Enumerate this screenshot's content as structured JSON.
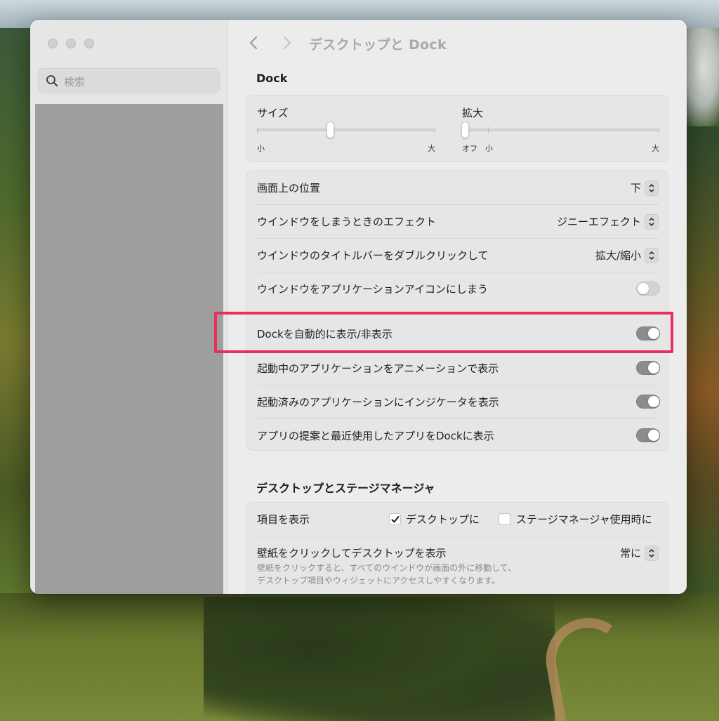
{
  "window": {
    "title": "デスクトップと Dock"
  },
  "sidebar": {
    "search_placeholder": "検索"
  },
  "dock": {
    "section_title": "Dock",
    "size": {
      "label": "サイズ",
      "min_label": "小",
      "max_label": "大",
      "value_fraction": 0.4
    },
    "magnification": {
      "label": "拡大",
      "off_label": "オフ",
      "min_label": "小",
      "max_label": "大",
      "value_fraction": 0.0
    },
    "position_label": "画面上の位置",
    "position_value": "下",
    "minimize_effect_label": "ウインドウをしまうときのエフェクト",
    "minimize_effect_value": "ジニーエフェクト",
    "titlebar_doubleclick_label": "ウインドウのタイトルバーをダブルクリックして",
    "titlebar_doubleclick_value": "拡大/縮小",
    "minimize_to_icon_label": "ウインドウをアプリケーションアイコンにしまう",
    "minimize_to_icon_on": false,
    "autohide_label": "Dockを自動的に表示/非表示",
    "autohide_on": true,
    "animate_label": "起動中のアプリケーションをアニメーションで表示",
    "animate_on": true,
    "indicators_label": "起動済みのアプリケーションにインジケータを表示",
    "indicators_on": true,
    "suggested_label": "アプリの提案と最近使用したアプリをDockに表示",
    "suggested_on": true
  },
  "desktop": {
    "section_title": "デスクトップとステージマネージャ",
    "show_items_label": "項目を表示",
    "on_desktop_label": "デスクトップに",
    "on_desktop_checked": true,
    "in_stage_manager_label": "ステージマネージャ使用時に",
    "in_stage_manager_checked": false,
    "click_wallpaper_label": "壁紙をクリックしてデスクトップを表示",
    "click_wallpaper_value": "常に",
    "click_wallpaper_desc_1": "壁紙をクリックすると、すべてのウインドウが画面の外に移動して、",
    "click_wallpaper_desc_2": "デスクトップ項目やウィジェットにアクセスしやすくなります。"
  },
  "colors": {
    "highlight": "#e8305f",
    "toggle_on": "#8c8c8c",
    "toggle_off": "#d3d3d3"
  }
}
